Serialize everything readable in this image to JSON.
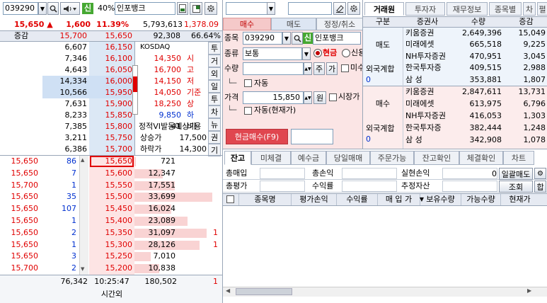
{
  "left": {
    "code": "039290",
    "credit_label": "신",
    "margin_rate": "40%",
    "stock_name": "인포뱅크",
    "price": "15,650",
    "change": "1,600",
    "rate": "11.39%",
    "volume": "5,793,613",
    "vol_ratio": "1,378.09",
    "header": {
      "label": "증감",
      "high": "15,700",
      "low": "15,650",
      "turnover": "92,308",
      "ratio": "66.64%"
    },
    "ask_rows": [
      {
        "qty": "6,607",
        "price": "16,150",
        "ask_color": "#c9dcef"
      },
      {
        "qty": "7,346",
        "price": "16,100"
      },
      {
        "qty": "4,643",
        "price": "16,050"
      },
      {
        "qty": "14,334",
        "price": "16,000"
      },
      {
        "qty": "10,566",
        "price": "15,950"
      },
      {
        "qty": "7,631",
        "price": "15,900"
      },
      {
        "qty": "8,233",
        "price": "15,850"
      },
      {
        "qty": "7,385",
        "price": "15,800"
      },
      {
        "qty": "3,211",
        "price": "15,750"
      },
      {
        "qty": "6,386",
        "price": "15,700"
      }
    ],
    "info": {
      "market": "KOSDAQ",
      "rows": [
        {
          "value": "14,350",
          "label": "시"
        },
        {
          "value": "16,700",
          "label": "고"
        },
        {
          "value": "14,150",
          "label": "저"
        },
        {
          "value": "14,050",
          "label": "기준"
        },
        {
          "value": "18,250",
          "label": "상"
        },
        {
          "value": "9,850",
          "label": "하"
        },
        {
          "value": "41",
          "label": "비용"
        }
      ],
      "vi_label": "정적VI발동예상가",
      "upper_label": "상승가",
      "upper_value": "17,500",
      "lower_label": "하락가",
      "lower_value": "14,300"
    },
    "side_tabs": [
      "투",
      "거",
      "외",
      "일",
      "투",
      "차",
      "뉴",
      "권",
      "기"
    ],
    "bid_rows": [
      {
        "trade": "15,650",
        "tqty": "86",
        "price": "15,650",
        "qty": "721"
      },
      {
        "trade": "15,650",
        "tqty": "7",
        "price": "15,600",
        "qty": "12,347"
      },
      {
        "trade": "15,700",
        "tqty": "1",
        "price": "15,550",
        "qty": "17,551"
      },
      {
        "trade": "15,650",
        "tqty": "35",
        "price": "15,500",
        "qty": "33,699"
      },
      {
        "trade": "15,650",
        "tqty": "107",
        "price": "15,450",
        "qty": "16,024"
      },
      {
        "trade": "15,650",
        "tqty": "1",
        "price": "15,400",
        "qty": "23,089"
      },
      {
        "trade": "15,650",
        "tqty": "2",
        "price": "15,350",
        "qty": "31,097",
        "extra": "1"
      },
      {
        "trade": "15,650",
        "tqty": "1",
        "price": "15,300",
        "qty": "28,126",
        "extra": "1"
      },
      {
        "trade": "15,650",
        "tqty": "3",
        "price": "15,250",
        "qty": "7,010"
      },
      {
        "trade": "15,700",
        "tqty": "2",
        "price": "15,200",
        "qty": "10,838"
      }
    ],
    "footer": {
      "ask_total": "76,342",
      "time": "10:25:47",
      "bid_total": "180,502",
      "extra": "1",
      "after_hours": "시간외"
    }
  },
  "order": {
    "tabs": [
      "매수",
      "매도",
      "정정/취소"
    ],
    "code_label": "종목",
    "code": "039290",
    "credit": "신",
    "name": "인포뱅크",
    "type_label": "종류",
    "type_value": "보통",
    "cash": "현금",
    "credit_radio": "신용",
    "qty_label": "수량",
    "qty_btn_ju": "주",
    "qty_btn_ga": "가",
    "unfilled": "미수",
    "auto1": "자동",
    "price_label": "가격",
    "price": "15,850",
    "won": "원",
    "market_price": "시장가",
    "auto2": "자동(현재가)",
    "submit": "현금매수(F9)"
  },
  "broker": {
    "tabs": [
      "거래원",
      "투자자",
      "재무정보",
      "종목별",
      "차",
      "펼"
    ],
    "headers": [
      "구분",
      "증권사",
      "수량",
      "증감"
    ],
    "sell_label": "매도",
    "sell_rows": [
      {
        "name": "키움증권",
        "qty": "2,649,396",
        "chg": "15,049"
      },
      {
        "name": "미래에셋",
        "qty": "665,518",
        "chg": "9,225"
      },
      {
        "name": "NH투자증권",
        "qty": "470,951",
        "chg": "3,045"
      },
      {
        "name": "한국투자증",
        "qty": "409,515",
        "chg": "2,988"
      },
      {
        "name": "삼  성",
        "qty": "353,881",
        "chg": "1,807"
      }
    ],
    "foreign_label": "외국계합",
    "foreign_sell": "0",
    "buy_label": "매수",
    "buy_rows": [
      {
        "name": "키움증권",
        "qty": "2,847,611",
        "chg": "13,731"
      },
      {
        "name": "미래에셋",
        "qty": "613,975",
        "chg": "6,796"
      },
      {
        "name": "NH투자증권",
        "qty": "416,053",
        "chg": "1,303"
      },
      {
        "name": "한국투자증",
        "qty": "382,444",
        "chg": "1,248"
      },
      {
        "name": "삼  성",
        "qty": "342,908",
        "chg": "1,078"
      }
    ],
    "foreign_buy": "0"
  },
  "account": {
    "tabs": [
      "잔고",
      "미체결",
      "예수금",
      "당일매매",
      "주문가능",
      "잔고확인",
      "체결확인",
      "차트"
    ],
    "summary": [
      {
        "label": "총매입",
        "label2": "총손익",
        "label3": "실현손익",
        "value3": "0",
        "label4": "일괄매도"
      },
      {
        "label": "총평가",
        "label2": "수익률",
        "label3": "추정자산",
        "label4": "조회",
        "label5": "합"
      }
    ],
    "columns": [
      "종목명",
      "평가손익",
      "수익률",
      "매 입 가",
      "보유수량",
      "가능수량",
      "현재가"
    ]
  }
}
